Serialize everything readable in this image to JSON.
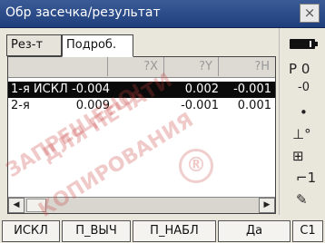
{
  "window": {
    "title": "Обр засечка/результат",
    "close_label": "×"
  },
  "tabs": [
    {
      "label": "Рез-т",
      "active": false
    },
    {
      "label": "Подроб.",
      "active": true
    }
  ],
  "table": {
    "columns": [
      "",
      "?X",
      "?Y",
      "?H"
    ],
    "rows": [
      {
        "name": "1-я ИСКЛ",
        "x": "-0.004",
        "y": "0.002",
        "h": "-0.001",
        "selected": true
      },
      {
        "name": "2-я",
        "x": "0.009",
        "y": "-0.001",
        "h": "0.001",
        "selected": false
      }
    ]
  },
  "scrollbar": {
    "left_arrow": "◀",
    "right_arrow": "▶"
  },
  "sidebar": {
    "battery": "battery-icon",
    "p0_label": "P 0",
    "prism_label": "-0",
    "dot_label": "•",
    "tilt_label": "⊥°",
    "mode_label": "⊞",
    "level_label": "⌐1",
    "sign_label": "✎"
  },
  "fkeys": [
    {
      "label": "ИСКЛ"
    },
    {
      "label": "П_ВЫЧ"
    },
    {
      "label": "П_НАБЛ"
    },
    {
      "label": "Да"
    },
    {
      "label": "С1"
    }
  ],
  "watermark": {
    "line1": "ЗАПРЕЩЕНО!",
    "line2": "ДЛЯ ПЕЧАТИ",
    "line3": "КОПИРОВАНИЯ",
    "reg": "®"
  },
  "colors": {
    "titlebar": "#1e3f7c",
    "selected_row": "#0a0a0a"
  }
}
